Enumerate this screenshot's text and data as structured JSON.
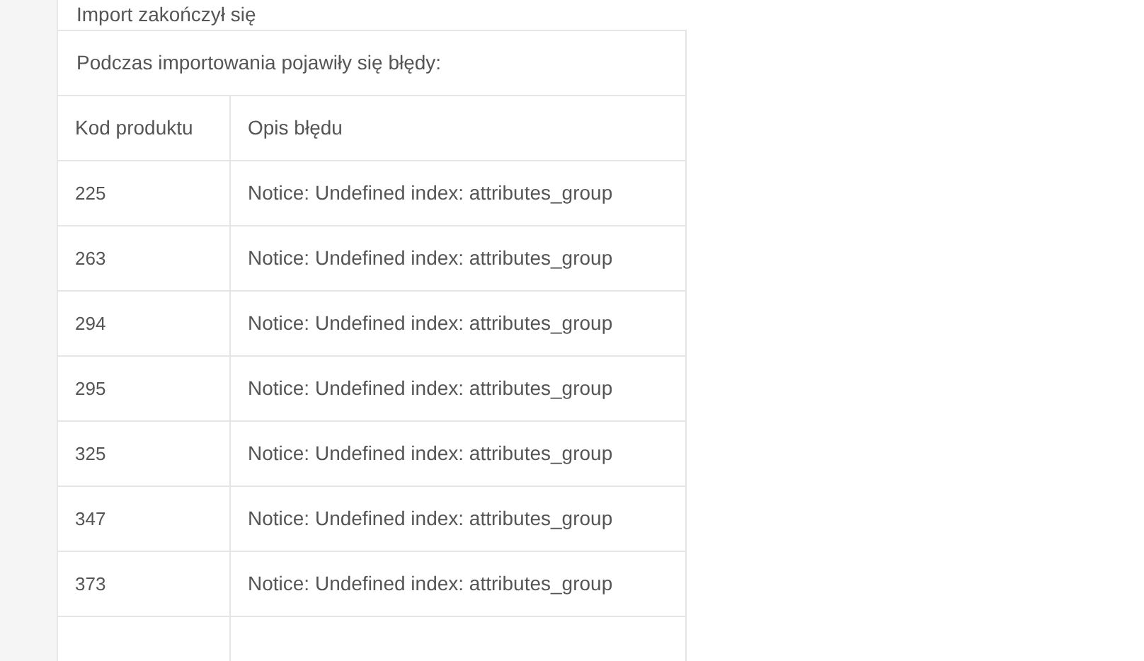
{
  "panel": {
    "title": "Import zakończył się"
  },
  "table": {
    "caption": "Podczas importowania pojawiły się błędy:",
    "columns": [
      "Kod produktu",
      "Opis błędu"
    ],
    "rows": [
      [
        "225",
        "Notice: Undefined index: attributes_group"
      ],
      [
        "263",
        "Notice: Undefined index: attributes_group"
      ],
      [
        "294",
        "Notice: Undefined index: attributes_group"
      ],
      [
        "295",
        "Notice: Undefined index: attributes_group"
      ],
      [
        "325",
        "Notice: Undefined index: attributes_group"
      ],
      [
        "347",
        "Notice: Undefined index: attributes_group"
      ],
      [
        "373",
        "Notice: Undefined index: attributes_group"
      ]
    ]
  }
}
